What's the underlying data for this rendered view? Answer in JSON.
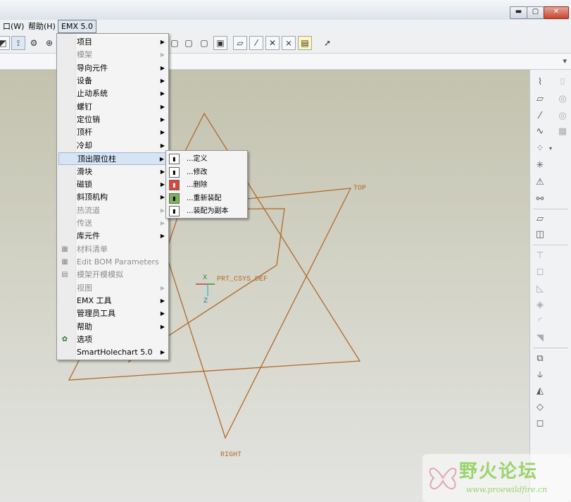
{
  "window": {
    "controls": {
      "minimize": "▬",
      "maximize": "▢",
      "close": "✕"
    }
  },
  "menubar": {
    "window_label": "口(W)",
    "help_label": "帮助(H)",
    "emx_label": "EMX 5.0"
  },
  "emx_menu": {
    "items": [
      {
        "label": "项目",
        "submenu": true,
        "enabled": true
      },
      {
        "label": "模架",
        "submenu": true,
        "enabled": false
      },
      {
        "label": "导向元件",
        "submenu": true,
        "enabled": true
      },
      {
        "label": "设备",
        "submenu": true,
        "enabled": true
      },
      {
        "label": "止动系统",
        "submenu": true,
        "enabled": true
      },
      {
        "label": "螺钉",
        "submenu": true,
        "enabled": true
      },
      {
        "label": "定位销",
        "submenu": true,
        "enabled": true
      },
      {
        "label": "顶杆",
        "submenu": true,
        "enabled": true
      },
      {
        "label": "冷却",
        "submenu": true,
        "enabled": true
      },
      {
        "label": "顶出限位柱",
        "submenu": true,
        "enabled": true,
        "highlighted": true
      },
      {
        "label": "滑块",
        "submenu": true,
        "enabled": true
      },
      {
        "label": "磁锁",
        "submenu": true,
        "enabled": true
      },
      {
        "label": "斜顶机构",
        "submenu": true,
        "enabled": true
      },
      {
        "label": "热流道",
        "submenu": true,
        "enabled": false
      },
      {
        "label": "传送",
        "submenu": true,
        "enabled": false
      },
      {
        "label": "库元件",
        "submenu": true,
        "enabled": true
      },
      {
        "label": "材料清单",
        "submenu": false,
        "enabled": false
      },
      {
        "label": "Edit BOM Parameters",
        "submenu": false,
        "enabled": false
      },
      {
        "label": "模架开模模拟",
        "submenu": false,
        "enabled": false
      },
      {
        "label": "视图",
        "submenu": true,
        "enabled": false
      },
      {
        "label": "EMX 工具",
        "submenu": true,
        "enabled": true
      },
      {
        "label": "管理员工具",
        "submenu": true,
        "enabled": true
      },
      {
        "label": "帮助",
        "submenu": true,
        "enabled": true
      },
      {
        "label": "选项",
        "submenu": false,
        "enabled": true
      },
      {
        "label": "SmartHolechart 5.0",
        "submenu": true,
        "enabled": true
      }
    ]
  },
  "submenu": {
    "items": [
      {
        "label": "...定义"
      },
      {
        "label": "...修改"
      },
      {
        "label": "...删除"
      },
      {
        "label": "...重新装配"
      },
      {
        "label": "...装配为副本"
      }
    ]
  },
  "canvas": {
    "datum_labels": {
      "top": "TOP",
      "right": "RIGHT",
      "csys": "PRT_CSYS_DEF"
    },
    "axis_labels": {
      "x": "X",
      "z": "Z"
    },
    "datum_color": "#b06a2b"
  },
  "watermark": {
    "title": "野火论坛",
    "url": "www.proewildfire.cn"
  }
}
